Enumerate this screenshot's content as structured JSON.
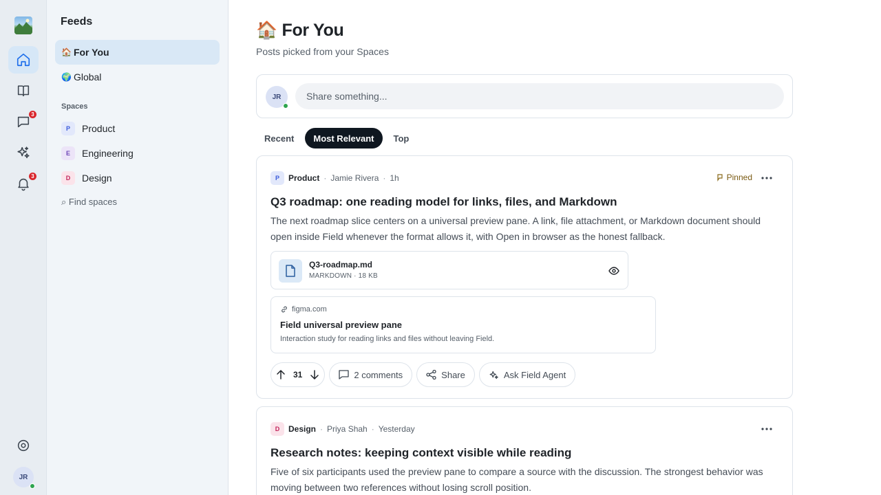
{
  "rail": {
    "nav": [
      {
        "icon": "home-icon",
        "active": true
      },
      {
        "icon": "book-icon",
        "active": false
      },
      {
        "icon": "chat-icon",
        "active": false,
        "badge": "3"
      },
      {
        "icon": "sparkles-icon",
        "active": false
      },
      {
        "icon": "bell-icon",
        "active": false,
        "badge": "3"
      }
    ],
    "settings_icon": "gear-icon",
    "user_initials": "JR"
  },
  "sidebar": {
    "title": "Feeds",
    "feeds": [
      {
        "emoji": "🏠",
        "label": "For You",
        "active": true
      },
      {
        "emoji": "🌍",
        "label": "Global",
        "active": false
      }
    ],
    "spaces_label": "Spaces",
    "spaces": [
      {
        "initial": "P",
        "label": "Product",
        "color": "#3b5bdb",
        "bg": "#e2e8fb"
      },
      {
        "initial": "E",
        "label": "Engineering",
        "color": "#7048b8",
        "bg": "#ece4f8"
      },
      {
        "initial": "D",
        "label": "Design",
        "color": "#c2255c",
        "bg": "#fbe3ea"
      }
    ],
    "find_spaces": "⌕ Find spaces"
  },
  "header": {
    "emoji": "🏠",
    "title": "For You",
    "subtitle": "Posts picked from your Spaces"
  },
  "composer": {
    "initials": "JR",
    "placeholder": "Share something..."
  },
  "tabs": [
    {
      "label": "Recent",
      "active": false
    },
    {
      "label": "Most Relevant",
      "active": true
    },
    {
      "label": "Top",
      "active": false
    }
  ],
  "posts": [
    {
      "space": "Product",
      "space_initial": "P",
      "author": "Jamie Rivera",
      "time": "1h",
      "pinned_label": "Pinned",
      "title": "Q3 roadmap: one reading model for links, files, and Markdown",
      "body": "The next roadmap slice centers on a universal preview pane. A link, file attachment, or Markdown document should open inside Field whenever the format allows it, with Open in browser as the honest fallback.",
      "attachment": {
        "name": "Q3-roadmap.md",
        "meta": "MARKDOWN · 18 KB"
      },
      "link": {
        "domain": "figma.com",
        "title": "Field universal preview pane",
        "description": "Interaction study for reading links and files without leaving Field."
      },
      "votes": "31",
      "comments_label": "2 comments",
      "share_label": "Share",
      "agent_label": "Ask Field Agent"
    },
    {
      "space": "Design",
      "space_initial": "D",
      "author": "Priya Shah",
      "time": "Yesterday",
      "title": "Research notes: keeping context visible while reading",
      "body": "Five of six participants used the preview pane to compare a source with the discussion. The strongest behavior was moving between two references without losing scroll position."
    }
  ],
  "colors": {
    "accent": "#1f6feb",
    "rail_bg": "#e8edf2",
    "sidebar_bg": "#f1f5f9",
    "active_item_bg": "#d9e8f6",
    "badge_red": "#d9262c",
    "online_green": "#2ea44f",
    "tab_active_bg": "#0f1720"
  }
}
